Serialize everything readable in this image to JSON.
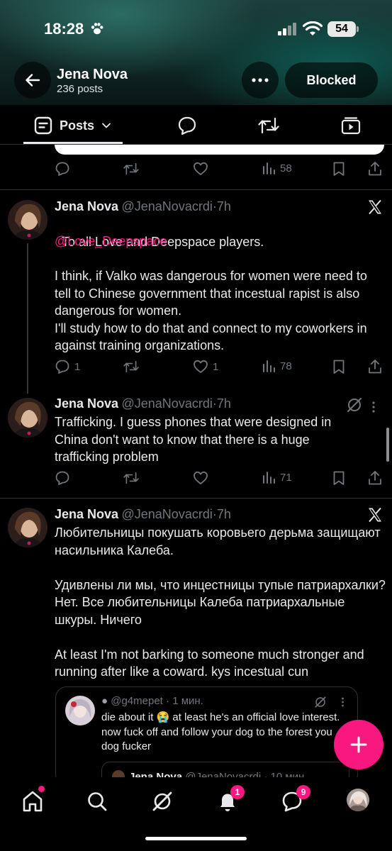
{
  "status_bar": {
    "time": "18:28",
    "battery": "54"
  },
  "header": {
    "name": "Jena Nova",
    "posts_count": "236 posts",
    "blocked_label": "Blocked"
  },
  "tabs": {
    "active_label": "Posts"
  },
  "prev_tweet": {
    "views": "58"
  },
  "tweets": [
    {
      "name": "Jena Nova",
      "handle": "@JenaNovacrdi",
      "time": "7h",
      "text": "To all Love and Deepspace players.",
      "mention": "@Love_Deepspace",
      "text2": "I think, if Valko was dangerous for women were need to tell to Chinese government that incestual rapist is also dangerous for women.\nI'll study how to do that and connect to my coworkers in against training organizations.",
      "replies": "1",
      "likes": "1",
      "views": "78"
    },
    {
      "name": "Jena Nova",
      "handle": "@JenaNovacrdi",
      "time": "7h",
      "text": "Trafficking. I guess phones that were designed in China don't want to know that there is a huge trafficking problem",
      "views": "71"
    },
    {
      "name": "Jena Nova",
      "handle": "@JenaNovacrdi",
      "time": "7h",
      "text": "Любительницы покушать коровьего дерьма защищают насильника Калеба.\n\nУдивлены ли мы, что инцестницы тупые патриархалки? Нет. Все любительницы Калеба патриархальные шкуры. Ничего\n\nAt least I'm not barking to someone much stronger and running after like a coward. kys incestual cun",
      "quote": {
        "handle": "@g4mepet",
        "time": "1 мин.",
        "text_before_emoji": "die about it ",
        "emoji": "😭",
        "text_after_emoji": " at least he's an official love interest. now fuck off and follow your dog to the forest you dog fucker",
        "nested_name": "Jena Nova",
        "nested_handle": "@JenaNovacrdi",
        "nested_time": "10 мин."
      }
    }
  ],
  "bottom_nav": {
    "notifications_badge": "1",
    "messages_badge": "9"
  },
  "colors": {
    "accent": "#f91880",
    "muted": "#71767b",
    "text": "#e7e9ea",
    "divider": "#2f3336"
  }
}
